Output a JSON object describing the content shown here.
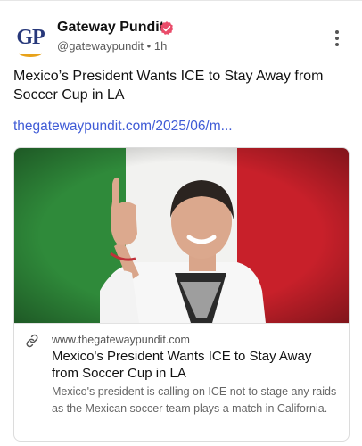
{
  "post": {
    "author_name": "Gateway Pundit",
    "author_handle": "@gatewaypundit",
    "time_ago": "1h",
    "separator": "•",
    "avatar_letters": "GP",
    "text": "Mexico’s President Wants ICE to Stay Away from Soccer Cup in LA",
    "link_text": "thegatewaypundit.com/2025/06/m..."
  },
  "card": {
    "domain": "www.thegatewaypundit.com",
    "title": "Mexico's President Wants ICE to Stay Away from Soccer Cup in LA",
    "description": "Mexico's president is calling on ICE not to stage any raids as the Mexican soccer team plays a match in California."
  },
  "colors": {
    "link": "#3f5bd6",
    "verified_badge": "#ea4c6a",
    "flag_green": "#2f8a3a",
    "flag_white": "#f2f2f0",
    "flag_red": "#c8202a",
    "avatar_text": "#27387a",
    "avatar_swoosh": "#e8a21a"
  },
  "icons": {
    "verified": "verified-badge-icon",
    "more": "more-vertical-icon",
    "link": "link-icon"
  }
}
